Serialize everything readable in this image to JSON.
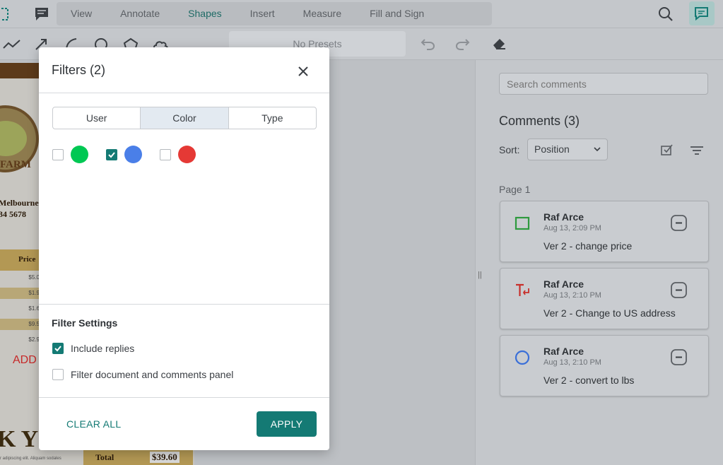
{
  "header": {
    "tabs": [
      {
        "label": "View"
      },
      {
        "label": "Annotate"
      },
      {
        "label": "Shapes"
      },
      {
        "label": "Insert"
      },
      {
        "label": "Measure"
      },
      {
        "label": "Fill and Sign"
      }
    ],
    "active_tab": "Shapes"
  },
  "toolbar": {
    "presets_label": "No Presets"
  },
  "document": {
    "text_melbourne": "Melbourne",
    "text_phone": "34 5678",
    "text_farm": "FARM",
    "text_price": "Price",
    "prices": [
      "$5.0",
      "$1.9",
      "$1.6",
      "$9.5",
      "$2.9"
    ],
    "text_add": "ADD",
    "text_thank": "K YO",
    "text_total_label": "Total",
    "text_total_value": "$39.60",
    "footer_text": "r adipiscing elit. Aliquam sodales"
  },
  "comments_panel": {
    "search_placeholder": "Search comments",
    "title": "Comments (3)",
    "sort_label": "Sort:",
    "sort_value": "Position",
    "page_label": "Page 1",
    "comments": [
      {
        "author": "Raf Arce",
        "date": "Aug 13, 2:09 PM",
        "text": "Ver 2 - change price",
        "icon": "rectangle-icon",
        "color": "#2e9a3e"
      },
      {
        "author": "Raf Arce",
        "date": "Aug 13, 2:10 PM",
        "text": "Ver 2 - Change to US address",
        "icon": "text-replace-icon",
        "color": "#c8302c"
      },
      {
        "author": "Raf Arce",
        "date": "Aug 13, 2:10 PM",
        "text": "Ver 2 - convert to lbs",
        "icon": "ellipse-icon",
        "color": "#3a6fd8"
      }
    ]
  },
  "modal": {
    "title": "Filters (2)",
    "tabs": [
      {
        "label": "User"
      },
      {
        "label": "Color"
      },
      {
        "label": "Type"
      }
    ],
    "active_tab": "Color",
    "colors": [
      {
        "color": "#00c853",
        "checked": false
      },
      {
        "color": "#4a7fe8",
        "checked": true
      },
      {
        "color": "#e53935",
        "checked": false
      }
    ],
    "settings_title": "Filter Settings",
    "include_replies_label": "Include replies",
    "include_replies_checked": true,
    "filter_doc_label": "Filter document and comments panel",
    "filter_doc_checked": false,
    "clear_label": "CLEAR ALL",
    "apply_label": "APPLY"
  },
  "colors": {
    "accent": "#147a74"
  }
}
